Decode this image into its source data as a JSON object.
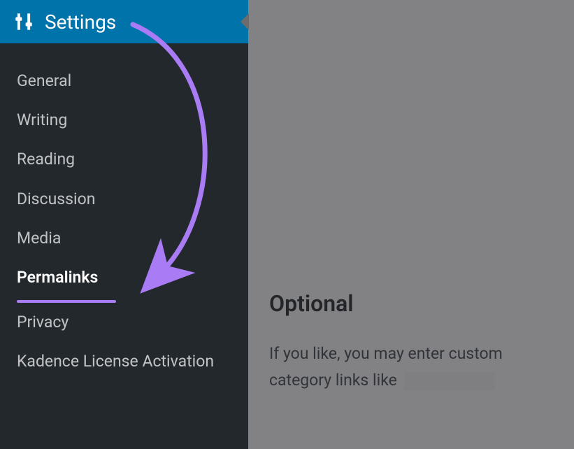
{
  "sidebar": {
    "title": "Settings",
    "items": [
      {
        "label": "General"
      },
      {
        "label": "Writing"
      },
      {
        "label": "Reading"
      },
      {
        "label": "Discussion"
      },
      {
        "label": "Media"
      },
      {
        "label": "Permalinks"
      },
      {
        "label": "Privacy"
      },
      {
        "label": "Kadence License Activation"
      }
    ]
  },
  "content": {
    "heading": "Optional",
    "body_line1": "If you like, you may enter custom",
    "body_line2": "category links like"
  }
}
